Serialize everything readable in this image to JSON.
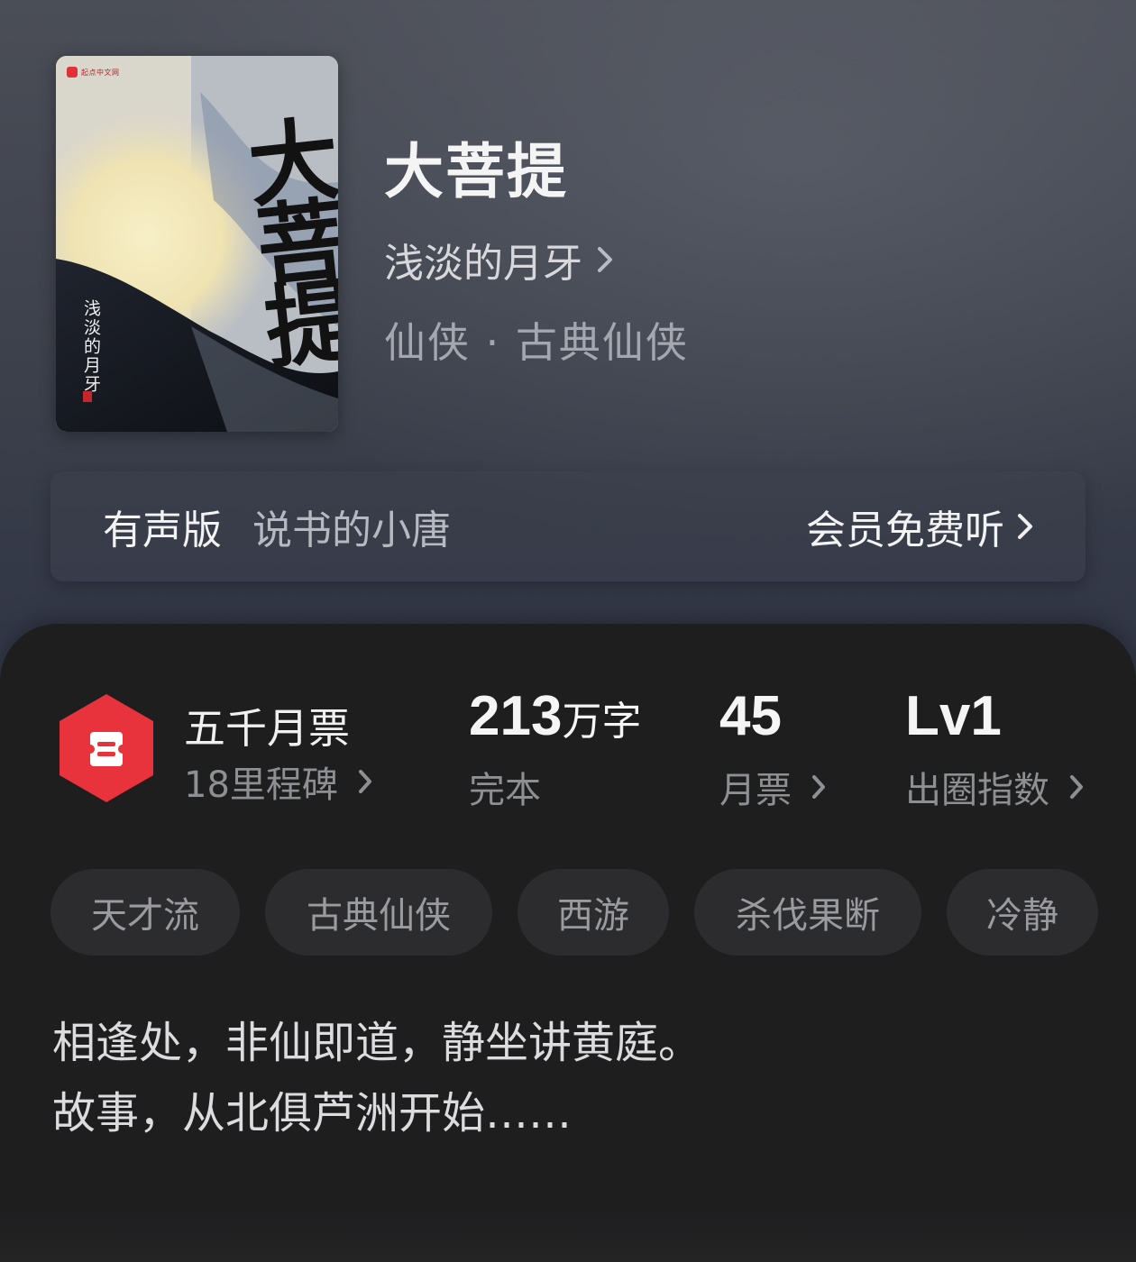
{
  "book": {
    "publisher_badge": "起点中文网",
    "cover_title": "大菩提",
    "cover_author": "浅淡的月牙",
    "title": "大菩提",
    "author": "浅淡的月牙",
    "genre": "仙侠 · 古典仙侠"
  },
  "audiobook": {
    "label": "有声版",
    "narrator": "说书的小唐",
    "cta": "会员免费听"
  },
  "stats": {
    "milestone_title": "五千月票",
    "milestone_sub": "18里程碑",
    "words_value": "213",
    "words_unit": "万字",
    "words_sub": "完本",
    "votes_value": "45",
    "votes_sub": "月票",
    "level_value": "Lv1",
    "level_sub": "出圈指数"
  },
  "tags": [
    "天才流",
    "古典仙侠",
    "西游",
    "杀伐果断",
    "冷静"
  ],
  "description": {
    "line1": "相逢处，非仙即道，静坐讲黄庭。",
    "line2": "故事，从北俱芦洲开始……"
  },
  "colors": {
    "badge_red": "#e8323c",
    "panel_bg": "#1e1e1f",
    "tag_bg": "#2c2c2e"
  }
}
